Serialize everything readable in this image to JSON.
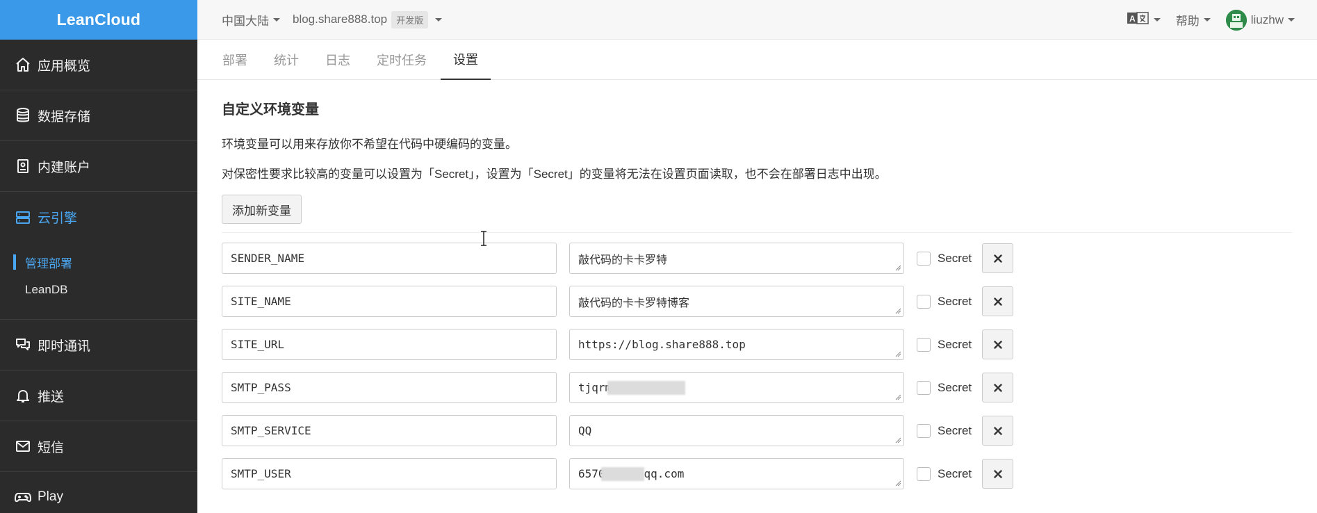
{
  "sidebar": {
    "brand": "LeanCloud",
    "items": [
      {
        "label": "应用概览",
        "icon": "home-icon"
      },
      {
        "label": "数据存储",
        "icon": "database-icon"
      },
      {
        "label": "内建账户",
        "icon": "id-card-icon"
      },
      {
        "label": "云引擎",
        "icon": "server-icon",
        "active": true,
        "sub": [
          {
            "label": "管理部署",
            "active": true
          },
          {
            "label": "LeanDB"
          }
        ]
      },
      {
        "label": "即时通讯",
        "icon": "chat-icon"
      },
      {
        "label": "推送",
        "icon": "bell-icon"
      },
      {
        "label": "短信",
        "icon": "mail-icon"
      },
      {
        "label": "Play",
        "icon": "gamepad-icon"
      }
    ]
  },
  "topbar": {
    "region": "中国大陆",
    "app": "blog.share888.top",
    "plan": "开发版",
    "help": "帮助",
    "user": "liuzhw"
  },
  "tabs": [
    "部署",
    "统计",
    "日志",
    "定时任务",
    "设置"
  ],
  "active_tab": "设置",
  "env": {
    "title": "自定义环境变量",
    "desc1": "环境变量可以用来存放你不希望在代码中硬编码的变量。",
    "desc2": "对保密性要求比较高的变量可以设置为「Secret」，设置为「Secret」的变量将无法在设置页面读取，也不会在部署日志中出现。",
    "add_label": "添加新变量",
    "secret_label": "Secret",
    "rows": [
      {
        "name": "SENDER_NAME",
        "value": "敲代码的卡卡罗特"
      },
      {
        "name": "SITE_NAME",
        "value": "敲代码的卡卡罗特博客"
      },
      {
        "name": "SITE_URL",
        "value": "https://blog.share888.top"
      },
      {
        "name": "SMTP_PASS",
        "value_prefix": "tjqrm",
        "value_suffix": ""
      },
      {
        "name": "SMTP_SERVICE",
        "value": "QQ"
      },
      {
        "name": "SMTP_USER",
        "value_prefix": "6570",
        "value_suffix": "qq.com"
      }
    ]
  },
  "colors": {
    "brand": "#3a99e8",
    "sidebar": "#2b2b2b",
    "active": "#4aa6f0"
  }
}
